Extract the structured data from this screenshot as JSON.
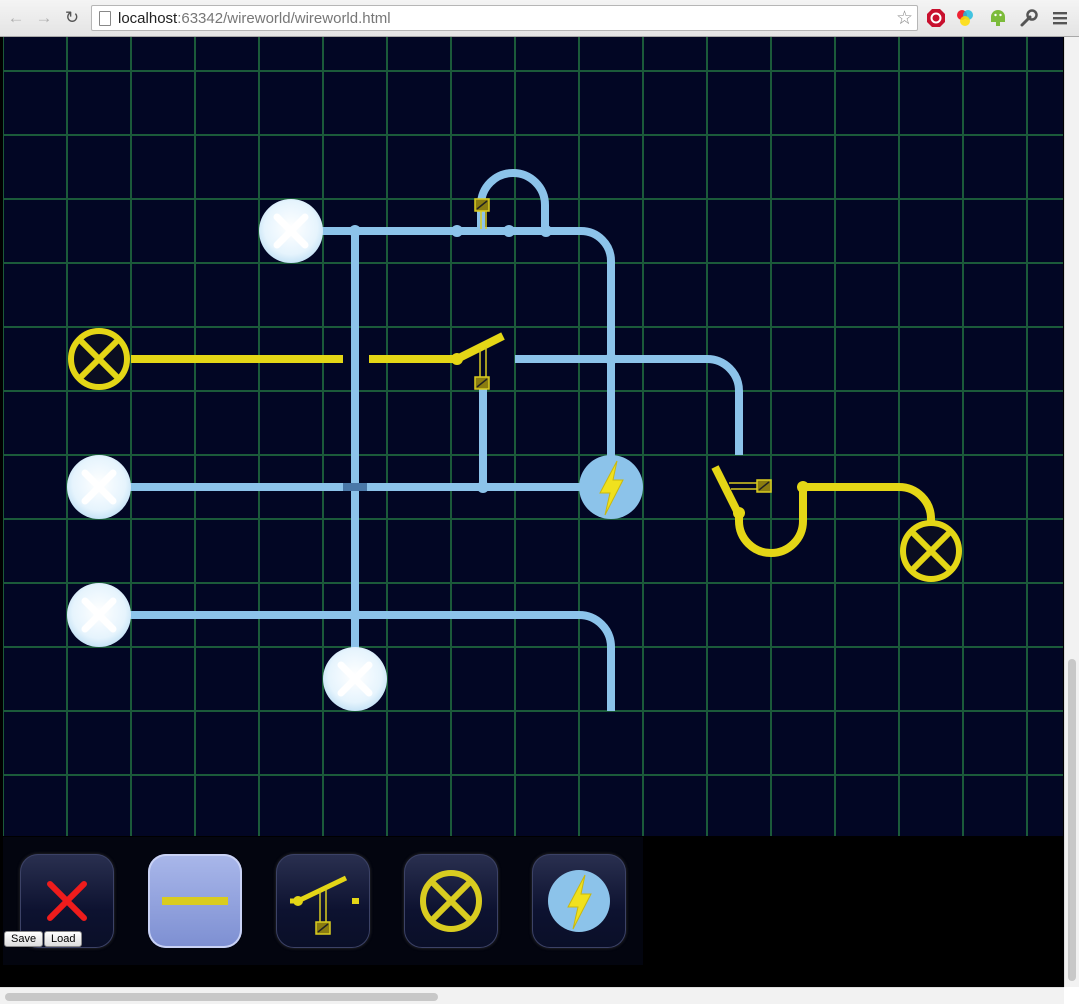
{
  "browser": {
    "url_host": "localhost",
    "url_rest": ":63342/wireworld/wireworld.html",
    "icons": [
      "back-arrow-icon",
      "forward-arrow-icon",
      "reload-icon",
      "page-icon",
      "star-icon",
      "adblock-icon",
      "color-picker-icon",
      "android-icon",
      "wrench-icon",
      "menu-icon"
    ]
  },
  "colors": {
    "background": "#020624",
    "grid": "#1b5a3a",
    "wire_idle": "#8cc3ea",
    "wire_powered": "#e4d616",
    "bulb_off": "#e9f5fd"
  },
  "board": {
    "components": [
      "lamp",
      "lamp",
      "lamp",
      "lamp",
      "lamp",
      "lamp",
      "switch",
      "switch",
      "switch",
      "power-source"
    ]
  },
  "toolbar": {
    "tools": [
      "delete-tool",
      "wire-tool",
      "switch-tool",
      "lamp-tool",
      "power-tool"
    ],
    "selected": "wire-tool"
  },
  "buttons": {
    "save": "Save",
    "load": "Load"
  }
}
